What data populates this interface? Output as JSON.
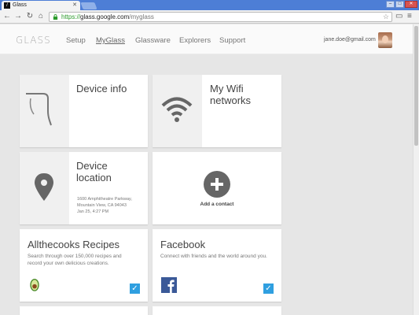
{
  "browser": {
    "tab_title": "Glass",
    "url_scheme": "https://",
    "url_host": "glass.google.com",
    "url_path": "/myglass"
  },
  "header": {
    "logo": "GLASS",
    "nav": [
      "Setup",
      "MyGlass",
      "Glassware",
      "Explorers",
      "Support"
    ],
    "active_nav": "MyGlass",
    "user_email": "jane.doe@gmail.com"
  },
  "cards": {
    "device_info": {
      "title": "Device info",
      "icon": "glass-frame-icon"
    },
    "wifi": {
      "title_line1": "My Wifi",
      "title_line2": "networks",
      "icon": "wifi-icon"
    },
    "location": {
      "title_line1": "Device",
      "title_line2": "location",
      "address_line1": "1600 Amphitheatre Parkway,",
      "address_line2": "Mountain View, CA 94043",
      "timestamp": "Jan 25, 4:27 PM",
      "icon": "map-pin-icon"
    },
    "add_contact": {
      "label": "Add a contact",
      "icon": "plus-icon"
    },
    "allthecooks": {
      "title": "Allthecooks Recipes",
      "desc_line1": "Search through over 150,000 recipes and",
      "desc_line2": "record your own delicious creations.",
      "checked": true,
      "icon": "avocado-icon"
    },
    "facebook": {
      "title": "Facebook",
      "desc_line1": "Connect with friends and the world around you.",
      "checked": true,
      "icon": "facebook-icon"
    }
  },
  "colors": {
    "accent": "#2f9fe0",
    "page_bg": "#e6e6e6",
    "facebook_blue": "#3b5998"
  }
}
